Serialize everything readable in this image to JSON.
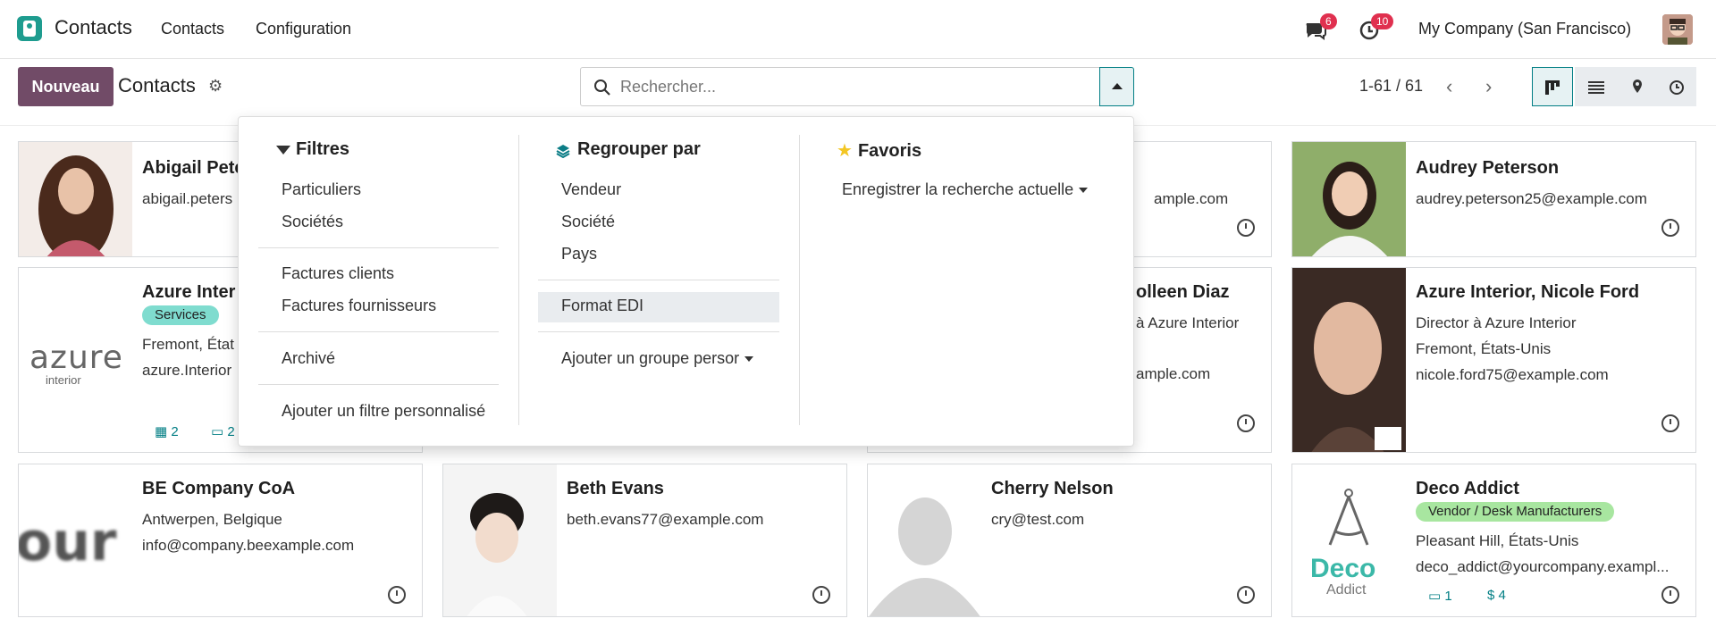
{
  "nav": {
    "app_title": "Contacts",
    "menu": [
      "Contacts",
      "Configuration"
    ],
    "messages_count": "6",
    "activities_count": "10",
    "company": "My Company (San Francisco)"
  },
  "control": {
    "new_button": "Nouveau",
    "title": "Contacts",
    "search_placeholder": "Rechercher...",
    "pager": "1-61 / 61"
  },
  "dropdown": {
    "filters": {
      "title": "Filtres",
      "items": [
        "Particuliers",
        "Sociétés",
        "Factures clients",
        "Factures fournisseurs",
        "Archivé",
        "Ajouter un filtre personnalisé"
      ]
    },
    "groupby": {
      "title": "Regrouper par",
      "items": [
        "Vendeur",
        "Société",
        "Pays",
        "Format EDI",
        "Ajouter un groupe persor"
      ]
    },
    "favorites": {
      "title": "Favoris",
      "items": [
        "Enregistrer la recherche actuelle"
      ]
    }
  },
  "cards": [
    {
      "name": "Abigail Pete",
      "lines": [
        "abigail.peters"
      ]
    },
    {
      "name": "",
      "lines": [
        "ample.com"
      ]
    },
    {
      "name": "Audrey Peterson",
      "lines": [
        "audrey.peterson25@example.com"
      ]
    },
    {
      "name": "Azure Inter",
      "tag": "Services",
      "lines": [
        "Fremont, État",
        "azure.Interior"
      ],
      "logo": "azure",
      "logo_sub": "interior",
      "stats": [
        "2",
        "2"
      ]
    },
    {
      "name": "olleen Diaz",
      "lines": [
        "à Azure Interior",
        "ample.com"
      ]
    },
    {
      "name": "Azure Interior, Nicole Ford",
      "lines": [
        "Director à Azure Interior",
        "Fremont, États-Unis",
        "nicole.ford75@example.com"
      ]
    },
    {
      "name": "BE Company CoA",
      "lines": [
        "Antwerpen, Belgique",
        "info@company.beexample.com"
      ],
      "logo": "our"
    },
    {
      "name": "Beth Evans",
      "lines": [
        "beth.evans77@example.com"
      ]
    },
    {
      "name": "Cherry Nelson",
      "lines": [
        "cry@test.com"
      ]
    },
    {
      "name": "Deco Addict",
      "tag": "Vendor / Desk Manufacturers",
      "lines": [
        "Pleasant Hill, États-Unis",
        "deco_addict@yourcompany.exampl..."
      ],
      "logo": "Deco",
      "logo_sub": "Addict",
      "stats": [
        "1",
        "$ 4"
      ]
    }
  ]
}
